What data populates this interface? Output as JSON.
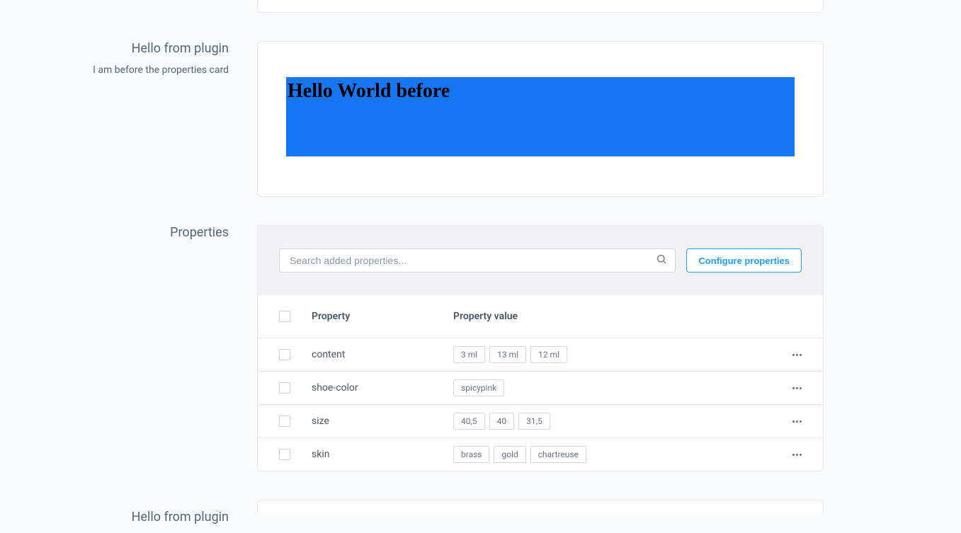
{
  "plugin_before": {
    "title": "Hello from plugin",
    "subtitle": "I am before the properties card",
    "banner_text": "Hello World before"
  },
  "properties": {
    "title": "Properties",
    "search_placeholder": "Search added properties...",
    "configure_label": "Configure properties",
    "columns": {
      "property": "Property",
      "value": "Property value"
    },
    "rows": [
      {
        "name": "content",
        "values": [
          "3 ml",
          "13 ml",
          "12 ml"
        ]
      },
      {
        "name": "shoe-color",
        "values": [
          "spicypink"
        ]
      },
      {
        "name": "size",
        "values": [
          "40,5",
          "40",
          "31,5"
        ]
      },
      {
        "name": "skin",
        "values": [
          "brass",
          "gold",
          "chartreuse"
        ]
      }
    ]
  },
  "plugin_after": {
    "title": "Hello from plugin"
  }
}
